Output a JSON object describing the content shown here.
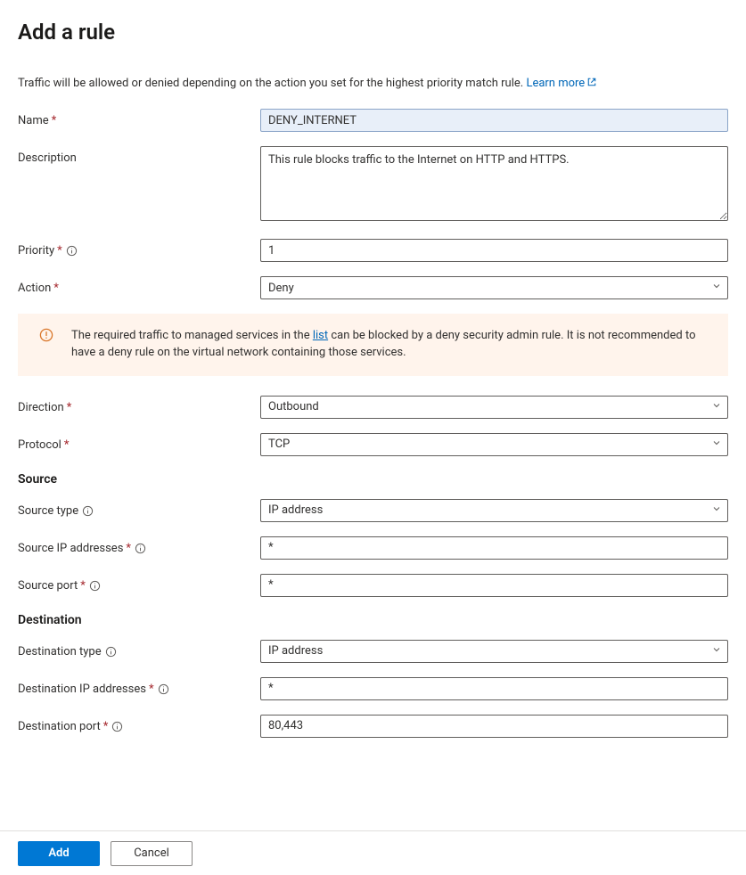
{
  "title": "Add a rule",
  "intro_text": "Traffic will be allowed or denied depending on the action you set for the highest priority match rule.",
  "learn_more_label": "Learn more",
  "fields": {
    "name": {
      "label": "Name",
      "value": "DENY_INTERNET"
    },
    "description": {
      "label": "Description",
      "value": "This rule blocks traffic to the Internet on HTTP and HTTPS."
    },
    "priority": {
      "label": "Priority",
      "value": "1"
    },
    "action": {
      "label": "Action",
      "value": "Deny"
    },
    "direction": {
      "label": "Direction",
      "value": "Outbound"
    },
    "protocol": {
      "label": "Protocol",
      "value": "TCP"
    },
    "source_type": {
      "label": "Source type",
      "value": "IP address"
    },
    "source_ip": {
      "label": "Source IP addresses",
      "value": "*"
    },
    "source_port": {
      "label": "Source port",
      "value": "*"
    },
    "destination_type": {
      "label": "Destination type",
      "value": "IP address"
    },
    "destination_ip": {
      "label": "Destination IP addresses",
      "value": "*"
    },
    "destination_port": {
      "label": "Destination port",
      "value": "80,443"
    }
  },
  "section_source": "Source",
  "section_destination": "Destination",
  "alert": {
    "pre": "The required traffic to managed services in the ",
    "link": "list",
    "post": " can be blocked by a deny security admin rule. It is not recommended to have a deny rule on the virtual network containing those services."
  },
  "buttons": {
    "add": "Add",
    "cancel": "Cancel"
  }
}
